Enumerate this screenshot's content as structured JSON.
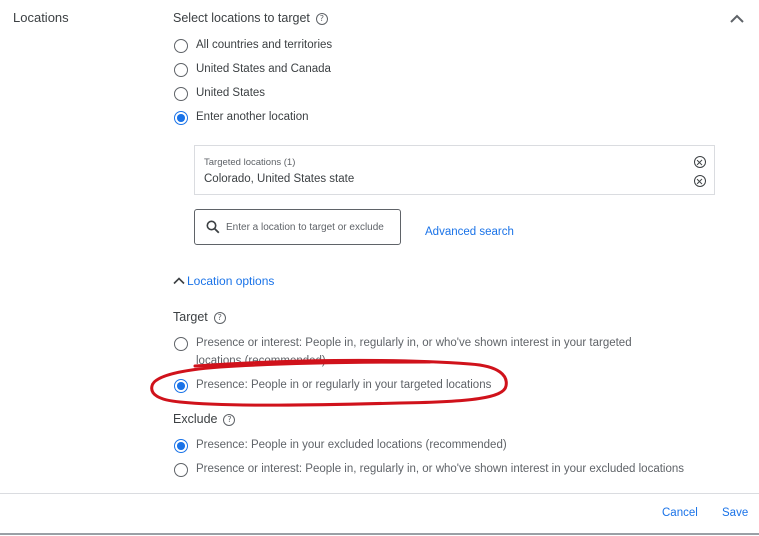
{
  "section": {
    "title": "Locations"
  },
  "select_locations": {
    "heading": "Select locations to target",
    "options": [
      "All countries and territories",
      "United States and Canada",
      "United States",
      "Enter another location"
    ],
    "selected_index": 3
  },
  "targeted_locations": {
    "title": "Targeted locations (1)",
    "items": [
      "Colorado, United States state"
    ]
  },
  "search": {
    "placeholder": "Enter a location to target or exclude"
  },
  "advanced_search": "Advanced search",
  "location_options": "Location options",
  "target": {
    "heading": "Target",
    "options": [
      "Presence or interest: People in, regularly in, or who've shown interest in your targeted locations (recommended)",
      "Presence: People in or regularly in your targeted locations"
    ],
    "selected_index": 1
  },
  "exclude": {
    "heading": "Exclude",
    "options": [
      "Presence: People in your excluded locations (recommended)",
      "Presence or interest: People in, regularly in, or who've shown interest in your excluded locations"
    ],
    "selected_index": 0
  },
  "footer": {
    "cancel": "Cancel",
    "save": "Save"
  },
  "colors": {
    "accent": "#1a73e8",
    "annotation": "#d0121b"
  }
}
